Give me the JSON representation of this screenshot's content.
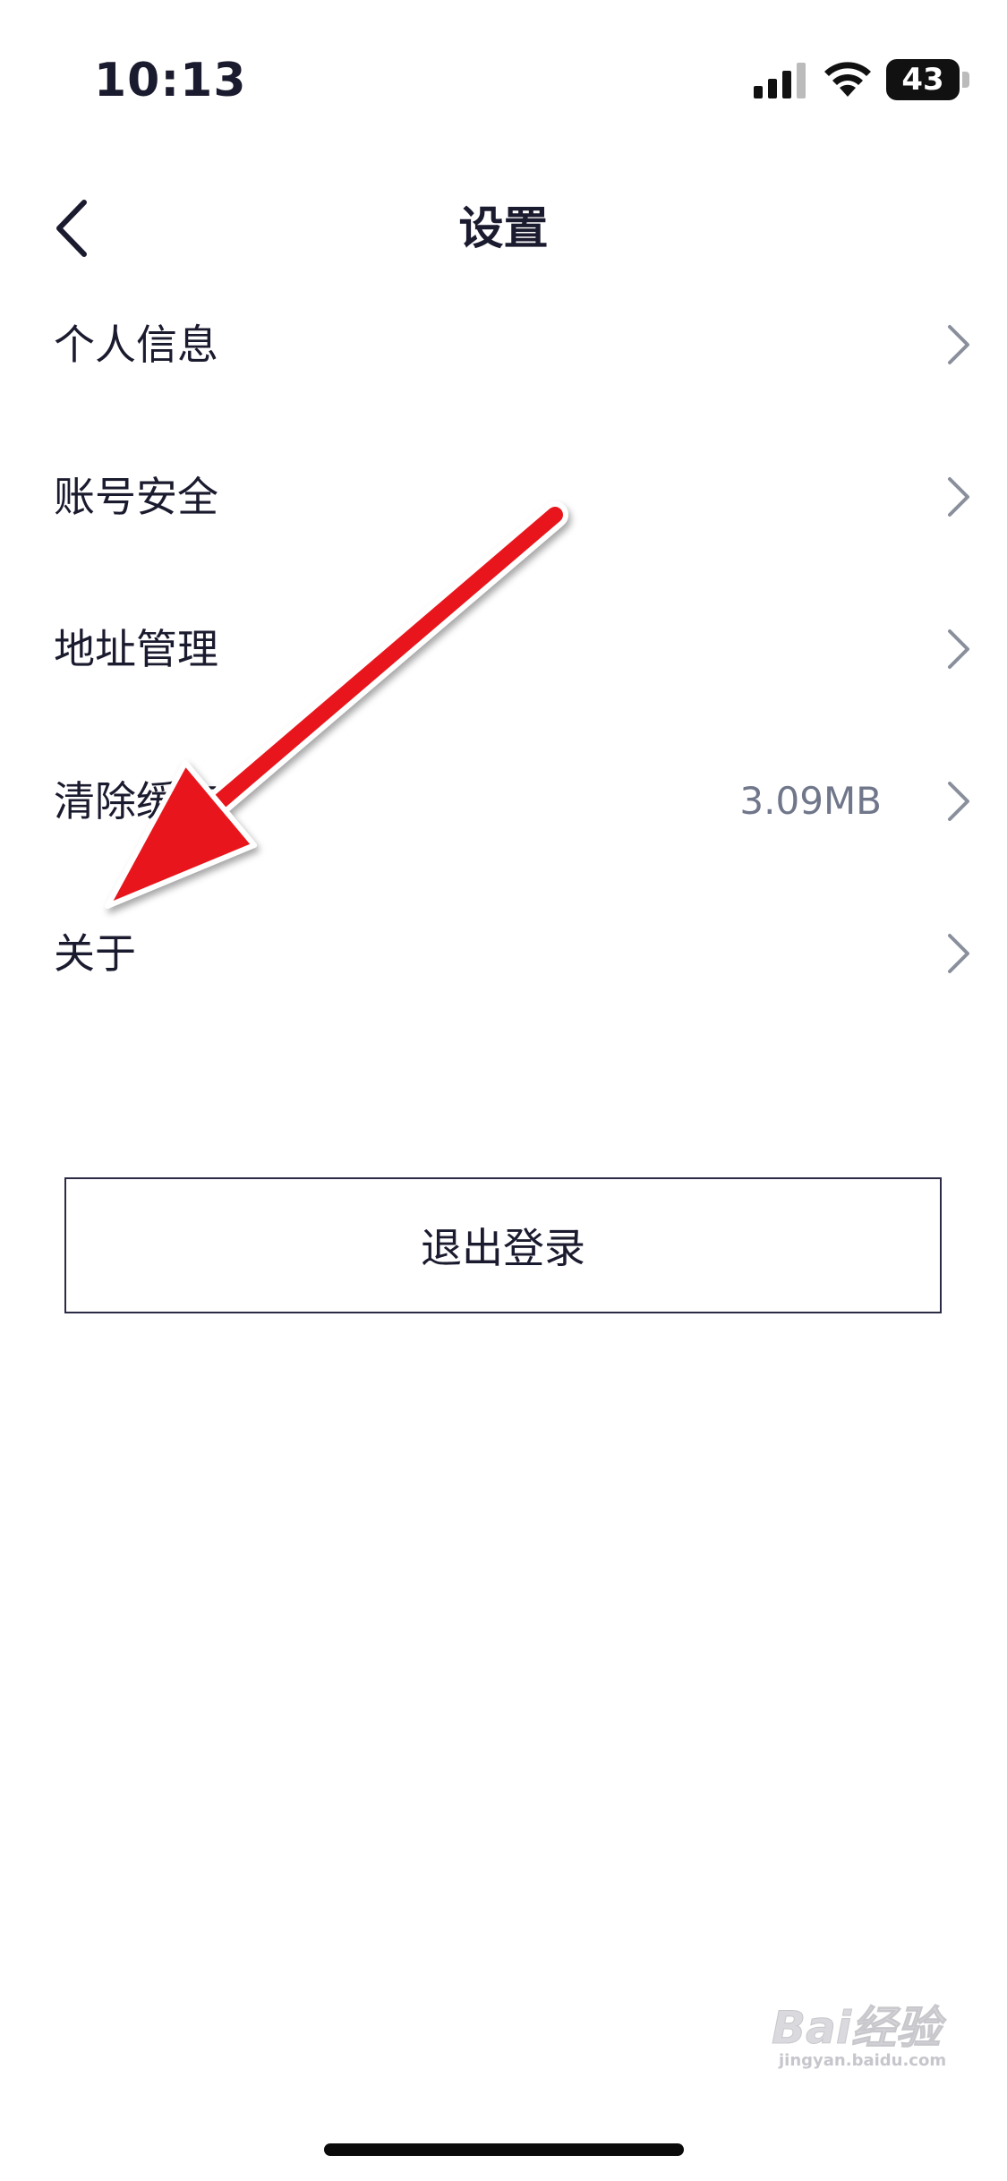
{
  "status_bar": {
    "time": "10:13",
    "battery_level": "43",
    "icons": [
      "signal-icon",
      "wifi-icon",
      "battery-icon"
    ]
  },
  "nav": {
    "title": "设置",
    "back_icon": "chevron-left-icon"
  },
  "settings": {
    "items": [
      {
        "label": "个人信息",
        "value": ""
      },
      {
        "label": "账号安全",
        "value": ""
      },
      {
        "label": "地址管理",
        "value": ""
      },
      {
        "label": "清除缓存",
        "value": "3.09MB"
      },
      {
        "label": "关于",
        "value": ""
      }
    ]
  },
  "logout": {
    "label": "退出登录"
  },
  "watermark": {
    "main": "Bai经验",
    "sub": "jingyan.baidu.com"
  },
  "colors": {
    "text": "#1b1b2f",
    "value_text": "#70778a",
    "annotation_arrow": "#e8141c",
    "background": "#ffffff"
  }
}
